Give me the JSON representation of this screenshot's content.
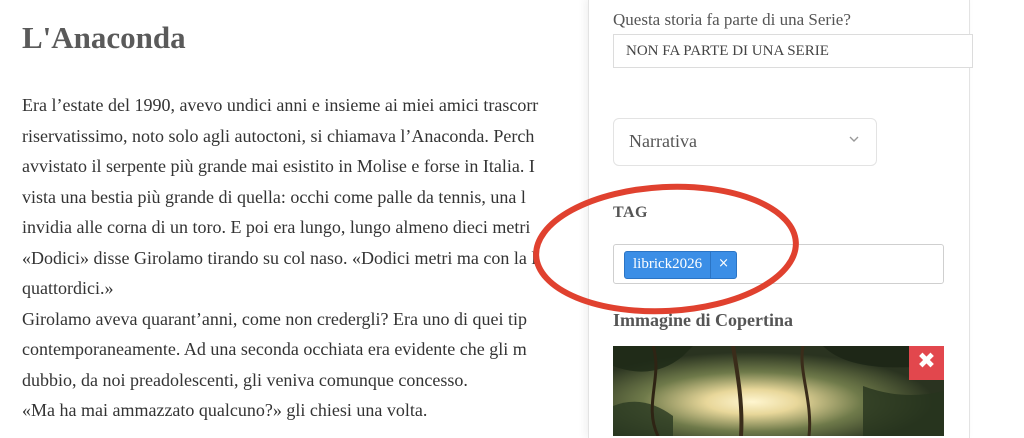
{
  "story": {
    "title": "L'Anaconda",
    "lines": [
      "Era l’estate del 1990, avevo undici anni e insieme ai miei amici trascorr",
      "riservatissimo, noto solo agli autoctoni, si chiamava l’Anaconda. Perch",
      "avvistato il serpente più grande mai esistito in Molise e forse in Italia. I",
      "vista una bestia più grande di quella: occhi come palle da tennis, una l",
      "invidia alle corna di un toro. E poi era lungo, lungo almeno dieci metri",
      "«Dodici» disse Girolamo tirando su col naso. «Dodici metri ma con la l",
      "quattordici.»",
      "Girolamo aveva quarant’anni, come non credergli? Era uno di quei tip",
      "contemporaneamente. Ad una seconda occhiata era evidente che gli m",
      "dubbio, da noi preadolescenti, gli veniva comunque concesso.",
      "«Ma ha mai ammazzato qualcuno?» gli chiesi una volta."
    ]
  },
  "sidebar": {
    "series_label": "Questa storia fa parte di una Serie?",
    "series_value": "NON FA PARTE DI UNA SERIE",
    "genre_value": "Narrativa",
    "tag_label": "TAG",
    "tags": [
      {
        "text": "librick2026",
        "remove": "×"
      }
    ],
    "cover_label": "Immagine di Copertina",
    "cover_remove": "✖"
  },
  "colors": {
    "tag_chip": "#3b8ee6",
    "annotation_circle": "#e0412f",
    "remove_button": "#e2474d"
  }
}
